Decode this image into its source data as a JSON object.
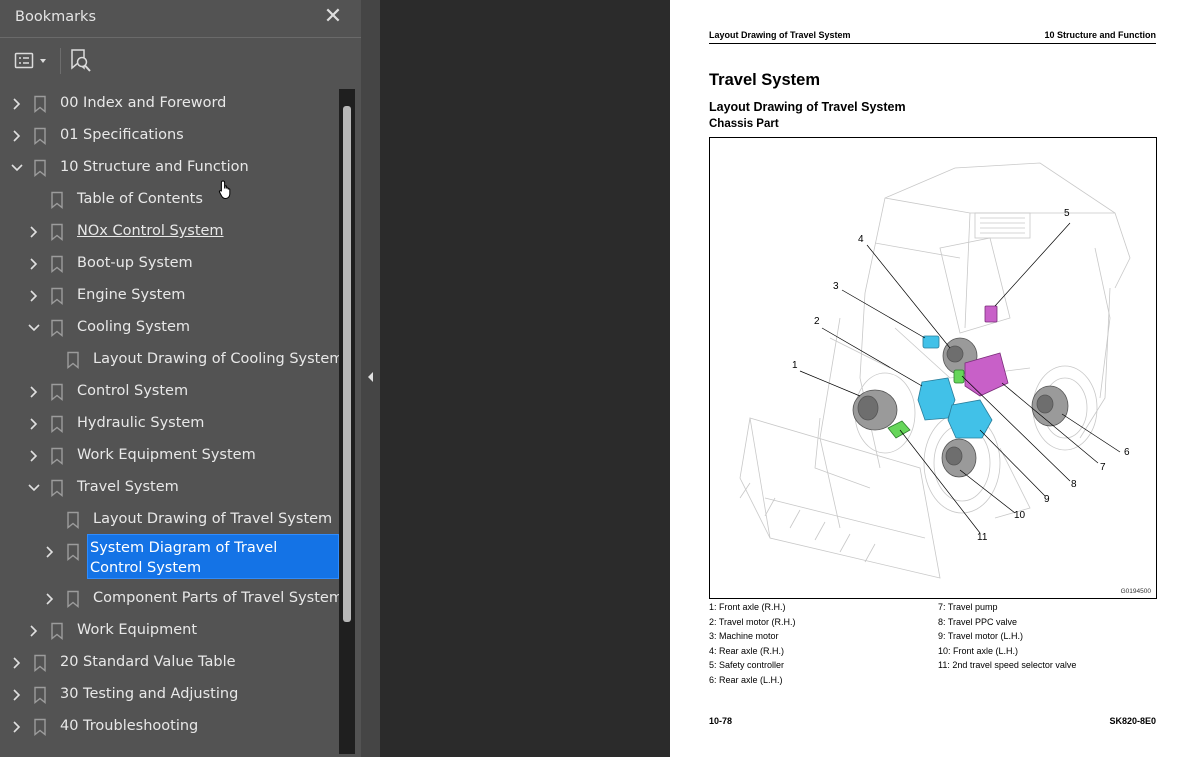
{
  "sidebar": {
    "title": "Bookmarks",
    "close_glyph": "✕",
    "toolbar": {
      "options_icon": "list-options-icon",
      "find_icon": "find-bookmark-icon"
    },
    "items": [
      {
        "label": "00 Index and Foreword",
        "level": 0,
        "state": "collapsed"
      },
      {
        "label": "01 Specifications",
        "level": 0,
        "state": "collapsed"
      },
      {
        "label": "10 Structure and Function",
        "level": 0,
        "state": "expanded"
      },
      {
        "label": "Table of Contents",
        "level": 1,
        "state": "leaf"
      },
      {
        "label": "NOx Control System",
        "level": 1,
        "state": "collapsed",
        "hover": true
      },
      {
        "label": "Boot-up System",
        "level": 1,
        "state": "collapsed"
      },
      {
        "label": "Engine System",
        "level": 1,
        "state": "collapsed"
      },
      {
        "label": "Cooling System",
        "level": 1,
        "state": "expanded"
      },
      {
        "label": "Layout Drawing of Cooling System",
        "level": 2,
        "state": "leaf"
      },
      {
        "label": "Control System",
        "level": 1,
        "state": "collapsed"
      },
      {
        "label": "Hydraulic System",
        "level": 1,
        "state": "collapsed"
      },
      {
        "label": "Work Equipment System",
        "level": 1,
        "state": "collapsed"
      },
      {
        "label": "Travel System",
        "level": 1,
        "state": "expanded"
      },
      {
        "label": "Layout Drawing of Travel System",
        "level": 2,
        "state": "leaf"
      },
      {
        "label": "System Diagram of Travel Control System",
        "level": 2,
        "state": "collapsed",
        "selected": true
      },
      {
        "label": "Component Parts of Travel System",
        "level": 2,
        "state": "collapsed"
      },
      {
        "label": "Work Equipment",
        "level": 1,
        "state": "collapsed"
      },
      {
        "label": "20 Standard Value Table",
        "level": 0,
        "state": "collapsed"
      },
      {
        "label": "30 Testing and Adjusting",
        "level": 0,
        "state": "collapsed"
      },
      {
        "label": "40 Troubleshooting",
        "level": 0,
        "state": "collapsed"
      }
    ],
    "colors": {
      "selected": "#1473e6",
      "panel": "#535353"
    }
  },
  "page": {
    "header_left": "Layout Drawing of Travel System",
    "header_right": "10 Structure and Function",
    "title": "Travel System",
    "subtitle": "Layout Drawing of Travel System",
    "section": "Chassis Part",
    "figure_code": "G0194500",
    "callouts": [
      "1",
      "2",
      "3",
      "4",
      "5",
      "6",
      "7",
      "8",
      "9",
      "10",
      "11"
    ],
    "legend_left": [
      "1: Front axle (R.H.)",
      "2: Travel motor (R.H.)",
      "3: Machine motor",
      "4: Rear axle (R.H.)",
      "5: Safety controller",
      "6: Rear axle (L.H.)"
    ],
    "legend_right": [
      "7: Travel pump",
      "8: Travel PPC valve",
      "9: Travel motor (L.H.)",
      "10: Front axle (L.H.)",
      "11: 2nd travel speed selector valve"
    ],
    "footer_left": "10-78",
    "footer_right": "SK820-8E0"
  }
}
